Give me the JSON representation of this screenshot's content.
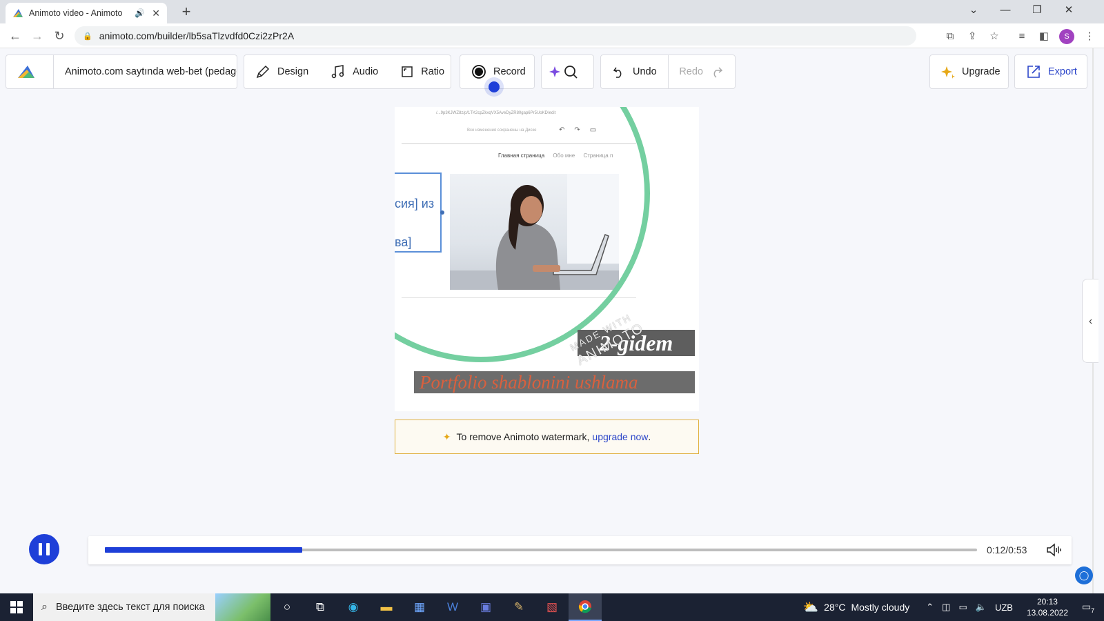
{
  "browser": {
    "tab_title": "Animoto video - Animoto",
    "new_tab": "+",
    "url": "animoto.com/builder/lb5saTlzvdfd0Czi2zPr2A",
    "profile_initial": "S"
  },
  "toolbar": {
    "project_name": "Animoto.com saytında web-bet (pedago",
    "design_label": "Design",
    "audio_label": "Audio",
    "ratio_label": "Ratio",
    "record_label": "Record",
    "undo_label": "Undo",
    "redo_label": "Redo",
    "upgrade_label": "Upgrade",
    "export_label": "Export"
  },
  "preview": {
    "screenshot_url": "/...9p3KJWZ8z/p/1TK2cpZkxqVX5AveDyZR80gap6Pr5UoKD/edit",
    "screenshot_hint": "Все изменения сохранены на Диске",
    "screenshot_nav": [
      "Главная страница",
      "Обо мне",
      "Страница п"
    ],
    "textbox_line1": "сия] из",
    "textbox_line2": "ва]",
    "caption_title": "2-gidem",
    "caption_subtitle": "Portfolio shablonini ushlama",
    "watermark_line1": "MADE WITH",
    "watermark_line2": "ANIMOTO"
  },
  "banner": {
    "text": "To remove Animoto watermark, ",
    "link": "upgrade now",
    "suffix": "."
  },
  "player": {
    "time": "0:12/0:53",
    "progress_fraction": 0.2264
  },
  "taskbar": {
    "search_placeholder": "Введите здесь текст для поиска",
    "temperature": "28°C",
    "weather": "Mostly cloudy",
    "language": "UZB",
    "time": "20:13",
    "date": "13.08.2022",
    "notifications": "7"
  },
  "colors": {
    "accent": "#1e3fd8",
    "ring": "#74cfa0",
    "banner_border": "#e0b040",
    "caption_red": "#d9603e"
  }
}
